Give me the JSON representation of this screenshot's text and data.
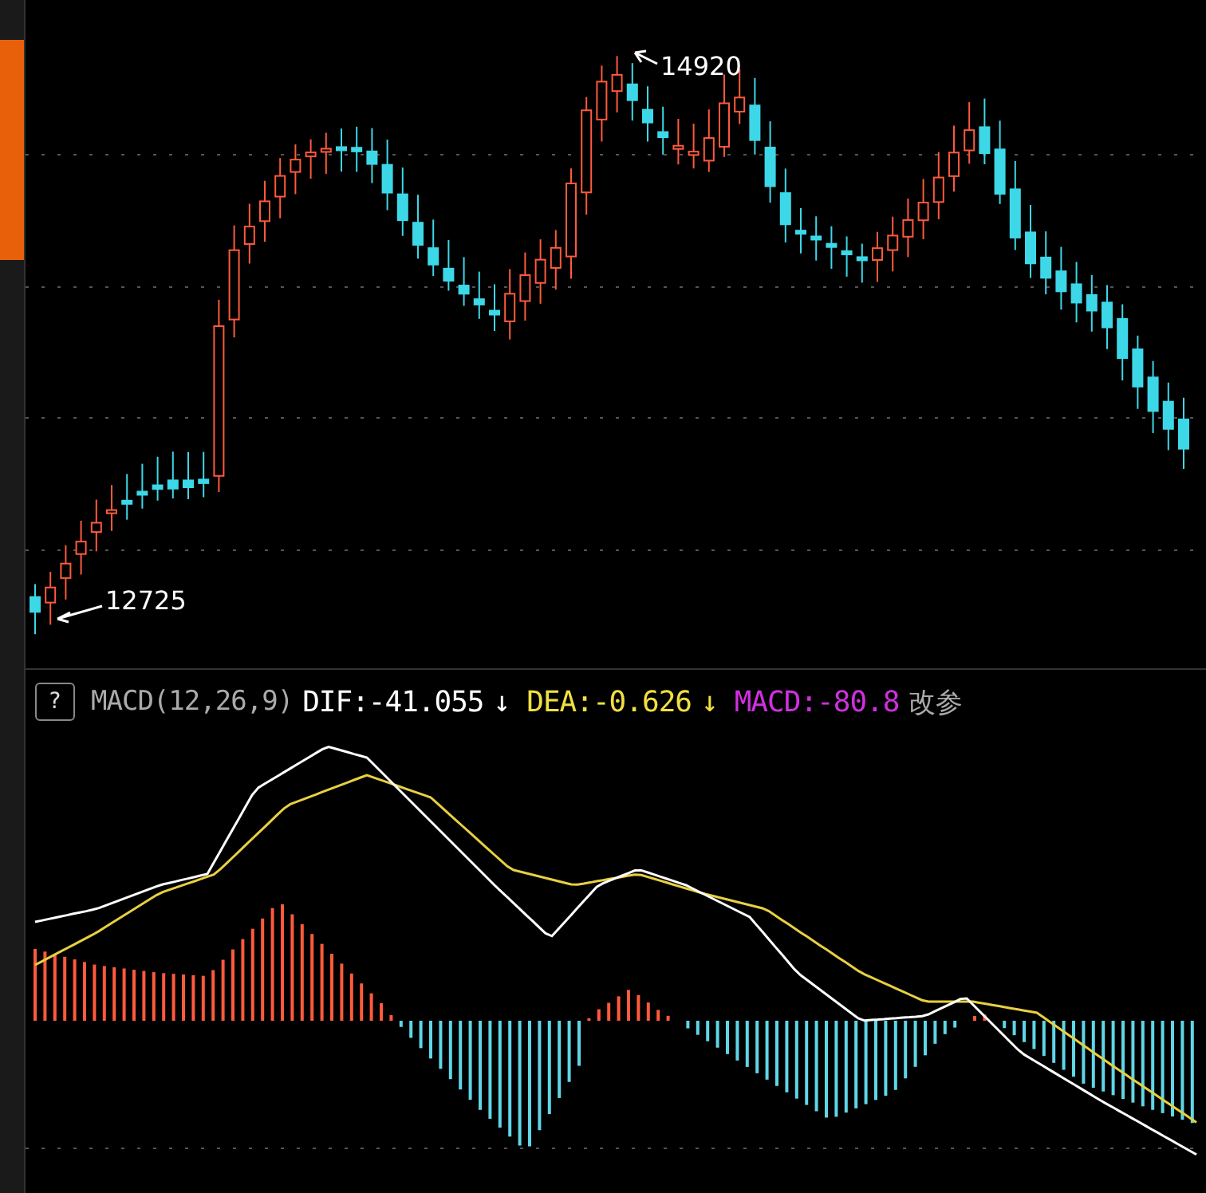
{
  "price_chart": {
    "high_label": "14920",
    "low_label": "12725"
  },
  "macd_panel": {
    "help_button": "?",
    "indicator": "MACD(12,26,9)",
    "readings": [
      {
        "kind": "dif",
        "text": "DIF:-41.055",
        "arrow": "↓"
      },
      {
        "kind": "dea",
        "text": "DEA:-0.626",
        "arrow": "↓"
      },
      {
        "kind": "macd",
        "text": "MACD:-80.8"
      }
    ],
    "settings_link": "改参"
  }
}
